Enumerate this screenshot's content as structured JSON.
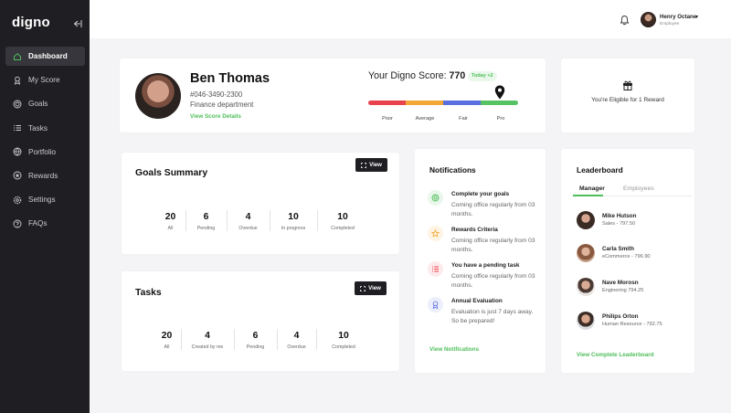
{
  "app": {
    "logo": "digno"
  },
  "sidebar": {
    "items": [
      {
        "label": "Dashboard",
        "icon": "home-icon",
        "active": true
      },
      {
        "label": "My Score",
        "icon": "score-icon"
      },
      {
        "label": "Goals",
        "icon": "target-icon"
      },
      {
        "label": "Tasks",
        "icon": "list-icon"
      },
      {
        "label": "Portfolio",
        "icon": "globe-icon"
      },
      {
        "label": "Rewards",
        "icon": "award-icon"
      },
      {
        "label": "Settings",
        "icon": "gear-icon"
      },
      {
        "label": "FAQs",
        "icon": "question-icon"
      }
    ]
  },
  "topbar": {
    "user_name": "Henry Octane",
    "user_role": "Employee"
  },
  "profile": {
    "name": "Ben Thomas",
    "phone": "#046-3490-2300",
    "department": "Finance department",
    "details_link": "View Score Details"
  },
  "score": {
    "label": "Your Digno Score:",
    "value": "770",
    "badge": "Today +2",
    "level": 0.88,
    "ticks": [
      "Poor",
      "Average",
      "Fair",
      "Pro"
    ]
  },
  "reward": {
    "text": "You're Eligible for 1 Reward"
  },
  "goals": {
    "title": "Goals Summary",
    "view_label": "View",
    "stats": [
      {
        "value": "20",
        "label": "All"
      },
      {
        "value": "6",
        "label": "Pending"
      },
      {
        "value": "4",
        "label": "Overdue"
      },
      {
        "value": "10",
        "label": "In progress"
      },
      {
        "value": "10",
        "label": "Completed"
      }
    ]
  },
  "tasks": {
    "title": "Tasks",
    "view_label": "View",
    "stats": [
      {
        "value": "20",
        "label": "All"
      },
      {
        "value": "4",
        "label": "Created by me"
      },
      {
        "value": "6",
        "label": "Pending"
      },
      {
        "value": "4",
        "label": "Overdue"
      },
      {
        "value": "10",
        "label": "Completed"
      }
    ]
  },
  "notifications": {
    "title": "Notifications",
    "items": [
      {
        "title": "Complete your goals",
        "desc": "Coming office regularly from 03 months."
      },
      {
        "title": "Rewards Criteria",
        "desc": "Coming office regularly from 03 months."
      },
      {
        "title": "You have a pending task",
        "desc": "Coming office regularly from 03 months."
      },
      {
        "title": "Annual Evaluation",
        "desc": "Evaluation is just 7 days away. So be prepared!"
      }
    ],
    "link": "View Notifications"
  },
  "leaderboard": {
    "title": "Leaderboard",
    "tabs": [
      "Manager",
      "Employees"
    ],
    "rows": [
      {
        "name": "Mike Hutson",
        "sub": "Sales - 797.50"
      },
      {
        "name": "Carla Smith",
        "sub": "eCommerce - 796.90"
      },
      {
        "name": "Nave Morosn",
        "sub": "Enginering 794.25"
      },
      {
        "name": "Philips Orton",
        "sub": "Human Resource - 792.75"
      }
    ],
    "link": "View Complete Leaderboard"
  },
  "colors": {
    "accent": "#4fbe5a",
    "sidebar": "#1f1f23",
    "score_poor": "#e8424d",
    "score_average": "#f3a736",
    "score_fair": "#5a6fe0",
    "score_pro": "#57c263"
  }
}
